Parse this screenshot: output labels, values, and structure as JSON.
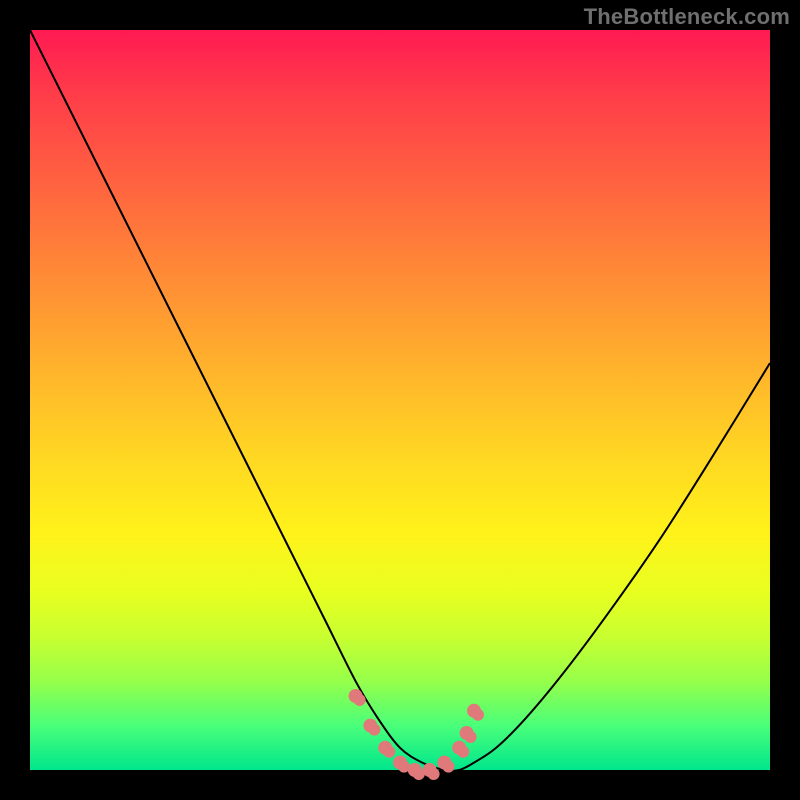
{
  "watermark": "TheBottleneck.com",
  "chart_data": {
    "type": "line",
    "title": "",
    "xlabel": "",
    "ylabel": "",
    "xlim": [
      0,
      100
    ],
    "ylim": [
      0,
      100
    ],
    "grid": false,
    "legend": false,
    "series": [
      {
        "name": "bottleneck-curve",
        "x": [
          0,
          5,
          10,
          15,
          20,
          25,
          30,
          35,
          40,
          44,
          47,
          50,
          53,
          56,
          58,
          60,
          63,
          67,
          72,
          78,
          85,
          92,
          100
        ],
        "values": [
          100,
          90,
          80,
          70,
          60,
          50,
          40,
          30,
          20,
          12,
          7,
          3,
          1,
          0,
          0,
          1,
          3,
          7,
          13,
          21,
          31,
          42,
          55
        ]
      }
    ],
    "markers": {
      "name": "optimal-zone-dots",
      "color": "#e07a7a",
      "x": [
        44,
        46,
        48,
        50,
        52,
        54,
        56,
        58,
        59,
        60
      ],
      "values": [
        10,
        6,
        3,
        1,
        0,
        0,
        1,
        3,
        5,
        8
      ]
    },
    "background_gradient": {
      "top": "#ff1a52",
      "mid": "#fff21a",
      "bottom": "#00e68c"
    }
  }
}
